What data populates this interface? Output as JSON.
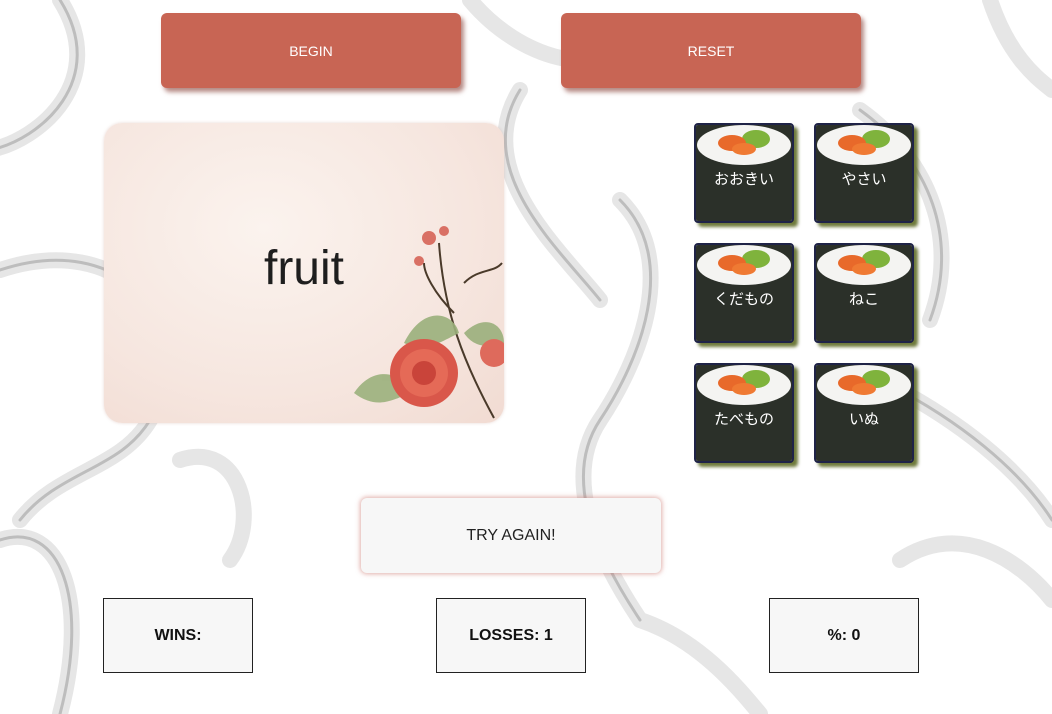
{
  "controls": {
    "begin_label": "BEGIN",
    "reset_label": "RESET"
  },
  "flashcard": {
    "word": "fruit"
  },
  "choices": [
    {
      "label": "おおきい"
    },
    {
      "label": "やさい"
    },
    {
      "label": "くだもの"
    },
    {
      "label": "ねこ"
    },
    {
      "label": "たべもの"
    },
    {
      "label": "いぬ"
    }
  ],
  "feedback": {
    "message": "TRY AGAIN!"
  },
  "stats": {
    "wins": "WINS:",
    "losses": "LOSSES: 1",
    "percent": "%: 0"
  },
  "colors": {
    "button_bg": "#c86554",
    "tile_border": "#1f2347",
    "tile_shadow": "#6f7a3c",
    "seaweed": "#2b3029",
    "rice": "#f4f4f2",
    "salmon_roe": "#e8692a",
    "avocado": "#7fb33c"
  },
  "icons": {
    "choice_tile": "sushi-roll-icon",
    "card_decoration": "rose-flower-icon",
    "background": "koi-fish-pattern"
  }
}
